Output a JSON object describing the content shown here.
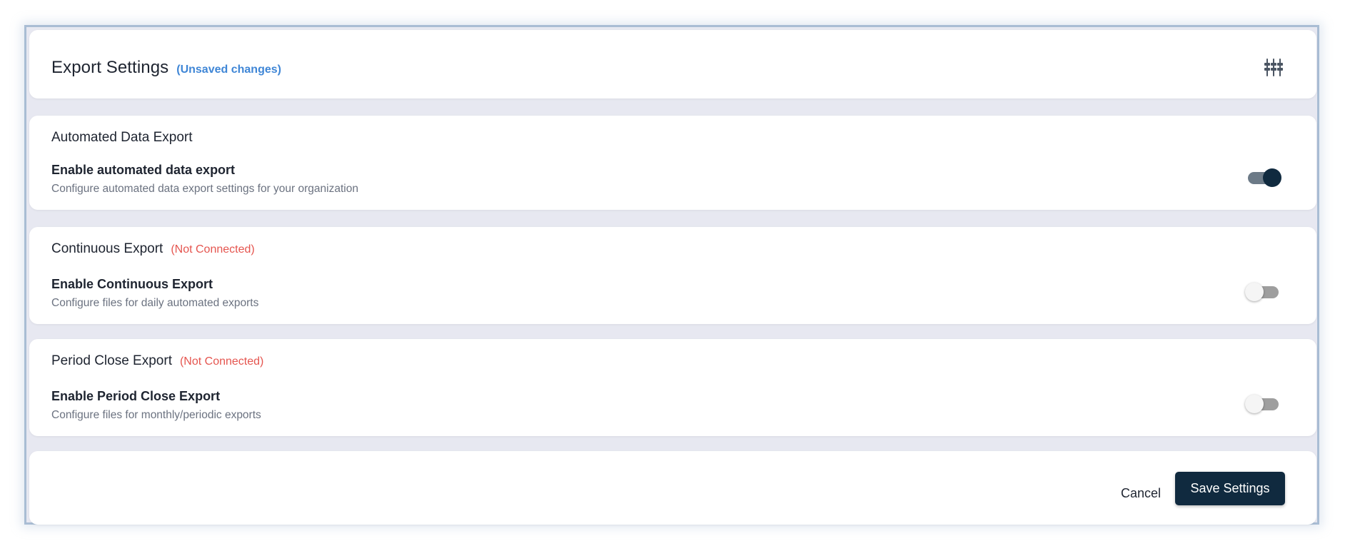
{
  "header": {
    "title": "Export Settings",
    "status": "(Unsaved changes)",
    "icon": "sliders-icon"
  },
  "sections": [
    {
      "title": "Automated Data Export",
      "status": "",
      "option_label": "Enable automated data export",
      "option_description": "Configure automated data export settings for your organization",
      "enabled": true
    },
    {
      "title": "Continuous Export",
      "status": "(Not Connected)",
      "option_label": "Enable Continuous Export",
      "option_description": "Configure files for daily automated exports",
      "enabled": false
    },
    {
      "title": "Period Close Export",
      "status": "(Not Connected)",
      "option_label": "Enable Period Close Export",
      "option_description": "Configure files for monthly/periodic exports",
      "enabled": false
    }
  ],
  "footer": {
    "cancel_label": "Cancel",
    "save_label": "Save Settings"
  },
  "colors": {
    "primary": "#102a3f",
    "unsaved": "#3f86d6",
    "not_connected": "#e5554f",
    "page_background": "#e7e8f1"
  }
}
